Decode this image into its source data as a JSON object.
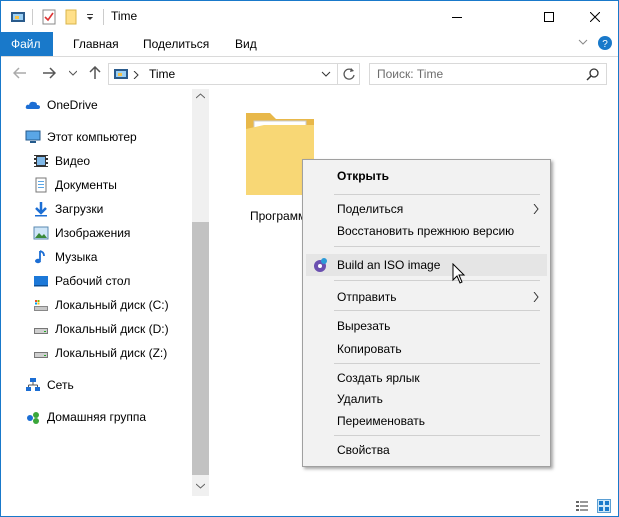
{
  "window": {
    "title": "Time",
    "accent": "#1979ca"
  },
  "ribbon": {
    "tabs": [
      "Файл",
      "Главная",
      "Поделиться",
      "Вид"
    ]
  },
  "address": {
    "path": "Time",
    "search_placeholder": "Поиск: Time"
  },
  "navpane": {
    "onedrive": "OneDrive",
    "this_pc": "Этот компьютер",
    "items": [
      "Видео",
      "Документы",
      "Загрузки",
      "Изображения",
      "Музыка",
      "Рабочий стол",
      "Локальный диск (C:)",
      "Локальный диск (D:)",
      "Локальный диск (Z:)"
    ],
    "network": "Сеть",
    "homegroup": "Домашняя группа"
  },
  "content": {
    "folder_label": "Программ"
  },
  "context_menu": {
    "open": "Открыть",
    "share": "Поделиться",
    "restore": "Восстановить прежнюю версию",
    "build_iso": "Build an ISO image",
    "send_to": "Отправить",
    "cut": "Вырезать",
    "copy": "Копировать",
    "create_shortcut": "Создать ярлык",
    "delete": "Удалить",
    "rename": "Переименовать",
    "properties": "Свойства"
  }
}
